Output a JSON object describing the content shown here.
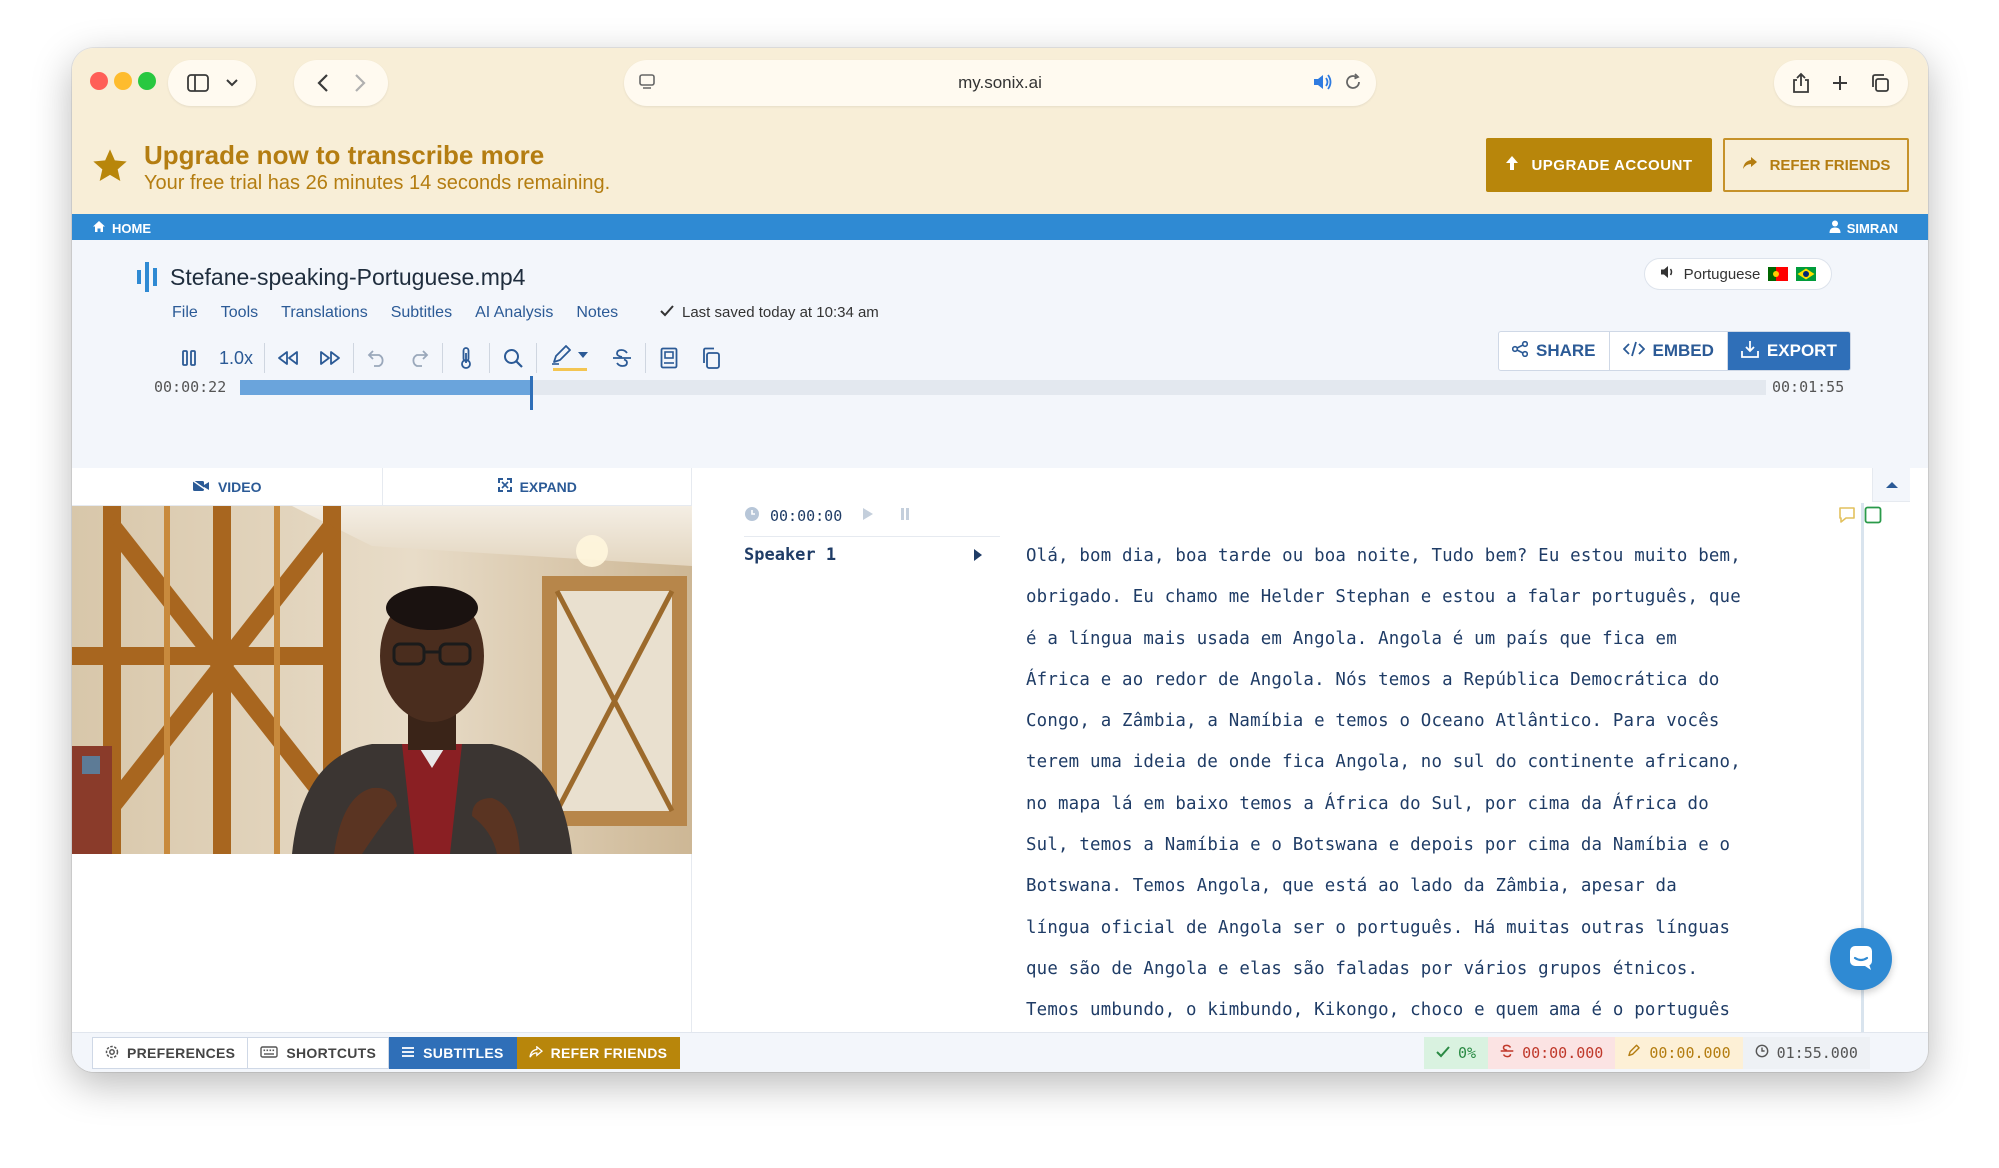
{
  "browser": {
    "url": "my.sonix.ai"
  },
  "banner": {
    "title": "Upgrade now to transcribe more",
    "subtitle": "Your free trial has 26 minutes 14 seconds remaining.",
    "upgrade_label": "UPGRADE ACCOUNT",
    "refer_label": "REFER FRIENDS"
  },
  "nav": {
    "home": "HOME",
    "user": "SIMRAN"
  },
  "editor": {
    "filename": "Stefane-speaking-Portuguese.mp4",
    "menu": [
      "File",
      "Tools",
      "Translations",
      "Subtitles",
      "AI Analysis",
      "Notes"
    ],
    "saved_status": "Last saved today at 10:34 am",
    "language": "Portuguese",
    "speed": "1.0x",
    "actions": {
      "share": "SHARE",
      "embed": "EMBED",
      "export": "EXPORT"
    },
    "current_time": "00:00:22",
    "total_time": "00:01:55",
    "progress_fraction": 0.19
  },
  "video_panel": {
    "video_tab": "VIDEO",
    "expand_tab": "EXPAND"
  },
  "transcript": {
    "segment_time": "00:00:00",
    "speaker": "Speaker 1",
    "lines": [
      "Olá, bom dia, boa tarde ou boa noite, Tudo bem? Eu estou muito bem,",
      "obrigado. Eu chamo me Helder Stephan e estou a falar português, que",
      "é a língua mais usada em Angola. Angola é um país que fica em",
      "África e ao redor de Angola. Nós temos a República Democrática do",
      "Congo, a Zâmbia, a Namíbia e temos o Oceano Atlântico. Para vocês",
      "terem uma ideia de onde fica Angola, no sul do continente africano,",
      "no mapa lá em baixo temos a África do Sul, por cima da África do",
      "Sul, temos a Namíbia e o Botswana e depois por cima da Namíbia e o",
      "Botswana. Temos Angola, que está ao lado da Zâmbia, apesar da",
      "língua oficial de Angola ser o português. Há muitas outras línguas",
      "que são de Angola e elas são faladas por vários grupos étnicos.",
      "Temos umbundo, o kimbundo, Kikongo, choco e quem ama é o português"
    ]
  },
  "footer": {
    "preferences": "PREFERENCES",
    "shortcuts": "SHORTCUTS",
    "subtitles": "SUBTITLES",
    "refer": "REFER FRIENDS",
    "accuracy": "0%",
    "strike_time": "00:00.000",
    "edit_time": "00:00.000",
    "duration": "01:55.000"
  },
  "colors": {
    "brand_blue": "#2f8ad3",
    "gold": "#b8860b",
    "banner_bg": "#f8eed7"
  }
}
